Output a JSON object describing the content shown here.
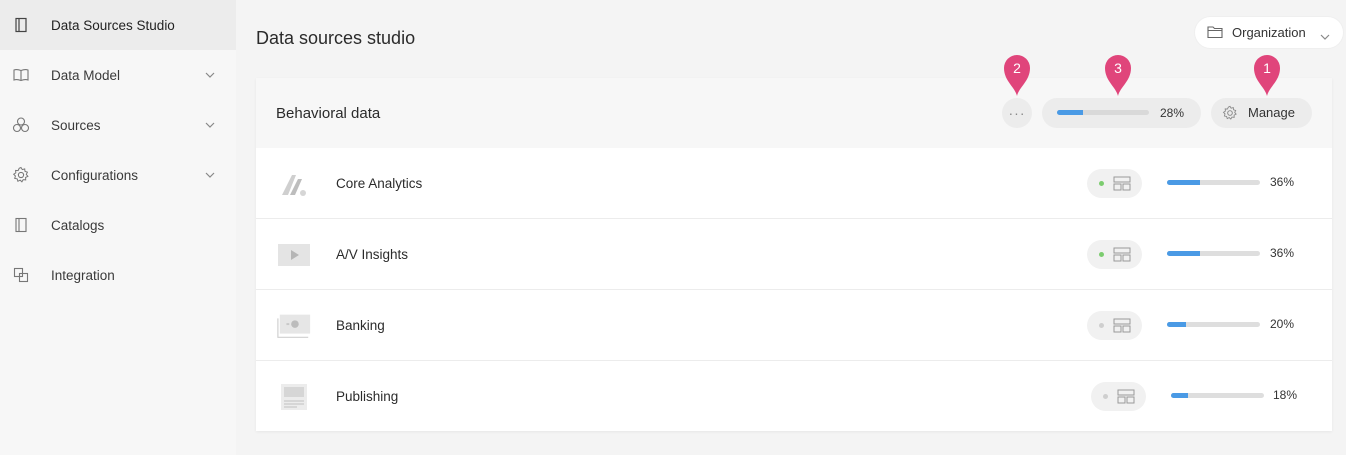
{
  "sidebar": {
    "items": [
      {
        "label": "Data Sources Studio",
        "icon": "catalog-icon",
        "has_chevron": false,
        "active": true
      },
      {
        "label": "Data Model",
        "icon": "book-icon",
        "has_chevron": true,
        "active": false
      },
      {
        "label": "Sources",
        "icon": "cluster-icon",
        "has_chevron": true,
        "active": false
      },
      {
        "label": "Configurations",
        "icon": "gear-icon",
        "has_chevron": true,
        "active": false
      },
      {
        "label": "Catalogs",
        "icon": "catalog-icon",
        "has_chevron": false,
        "active": false
      },
      {
        "label": "Integration",
        "icon": "integration-icon",
        "has_chevron": false,
        "active": false
      }
    ]
  },
  "header": {
    "title": "Data sources studio",
    "org_selector": {
      "label": "Organization",
      "icon": "folder-icon"
    }
  },
  "card": {
    "title": "Behavioral data",
    "more_label": "···",
    "progress": {
      "value": 0.28,
      "label": "28%"
    },
    "manage_label": "Manage",
    "rows": [
      {
        "name": "Core Analytics",
        "icon": "analytics-logo-icon",
        "status_color": "#7ccc6f",
        "progress": 0.36,
        "pct": "36%"
      },
      {
        "name": "A/V Insights",
        "icon": "video-icon",
        "status_color": "#7ccc6f",
        "progress": 0.36,
        "pct": "36%"
      },
      {
        "name": "Banking",
        "icon": "banknote-icon",
        "status_color": "#cfcfcf",
        "progress": 0.2,
        "pct": "20%"
      },
      {
        "name": "Publishing",
        "icon": "document-icon",
        "status_color": "#cfcfcf",
        "progress": 0.18,
        "pct": "18%"
      }
    ]
  },
  "annotations": [
    {
      "number": "1",
      "target": "manage-button"
    },
    {
      "number": "2",
      "target": "more-options-button"
    },
    {
      "number": "3",
      "target": "overall-progress"
    }
  ],
  "colors": {
    "accent": "#4a9ae5",
    "pin": "#e0457b",
    "status_active": "#7ccc6f",
    "status_inactive": "#cfcfcf"
  }
}
